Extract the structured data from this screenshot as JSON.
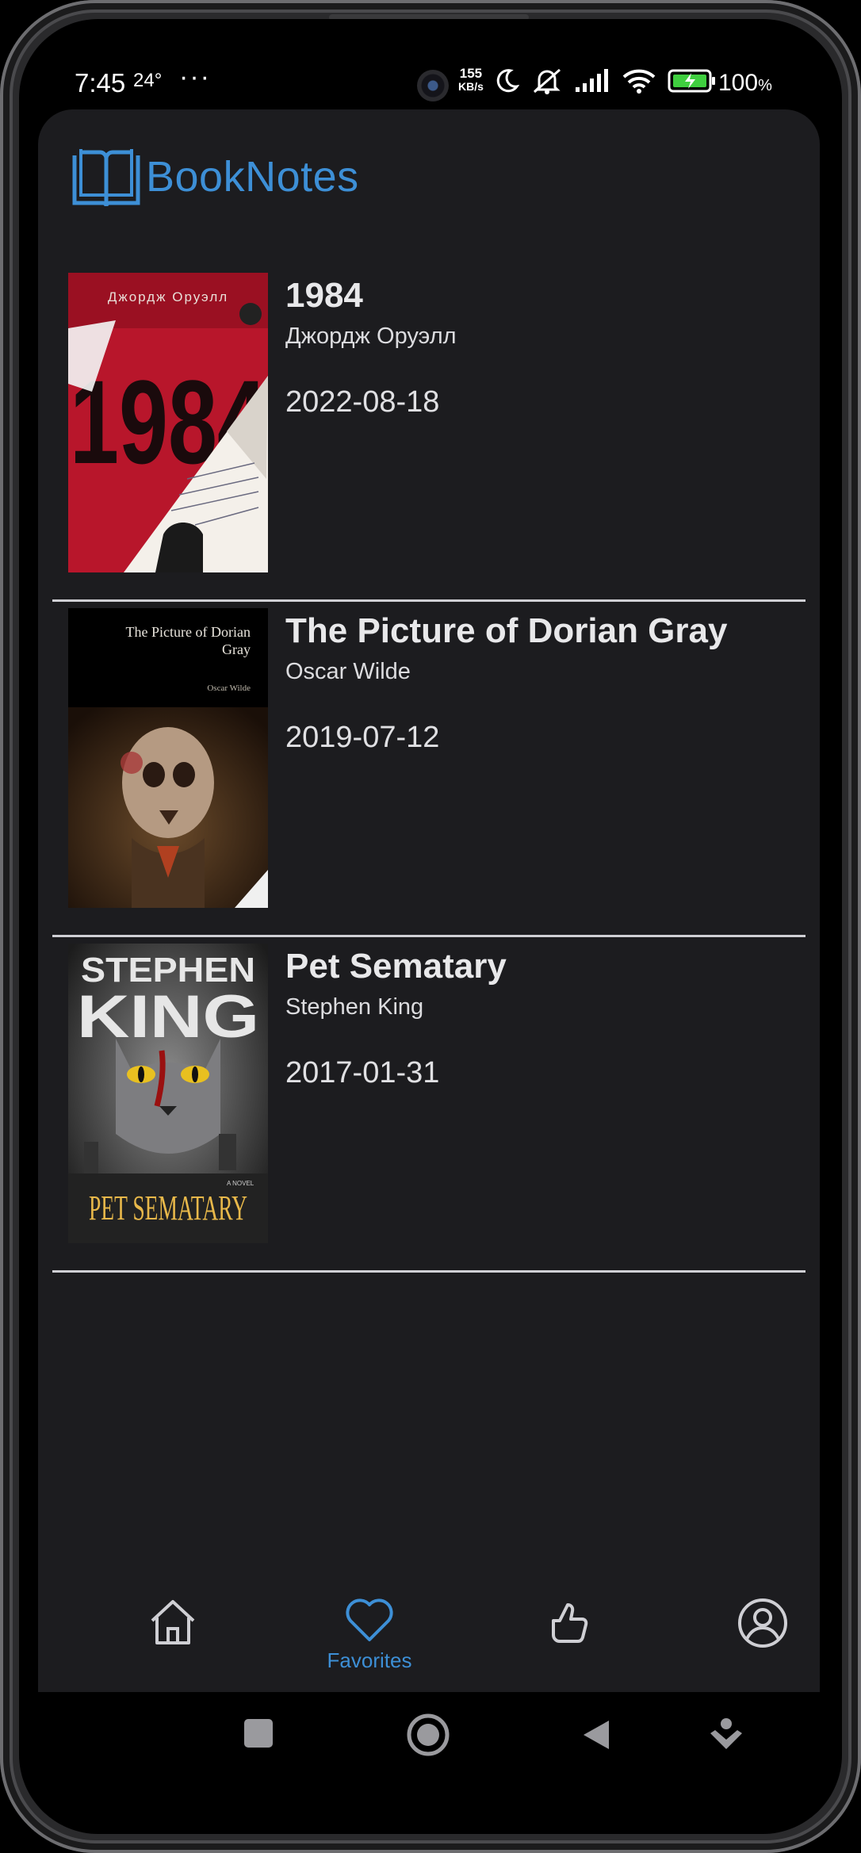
{
  "status_bar": {
    "time": "7:45",
    "temperature": "24°",
    "more": "···",
    "speed_value": "155",
    "speed_unit": "KB/s",
    "battery_percent": "100",
    "battery_unit": "%"
  },
  "app": {
    "name": "BookNotes",
    "accent_color": "#3d8fd6",
    "background_color": "#1c1c1f"
  },
  "books": [
    {
      "title": "1984",
      "author": "Джордж Оруэлл",
      "date": "2022-08-18",
      "cover": {
        "top_text": "Джордж Оруэлл",
        "big_text": "1984"
      }
    },
    {
      "title": "The Picture of Dorian Gray",
      "author": "Oscar Wilde",
      "date": "2019-07-12",
      "cover": {
        "title_line1": "The Picture of Dorian",
        "title_line2": "Gray",
        "author_text": "Oscar Wilde"
      }
    },
    {
      "title": "Pet Sematary",
      "author": "Stephen King",
      "date": "2017-01-31",
      "cover": {
        "author_line1": "STEPHEN",
        "author_line2": "KING",
        "title_text": "PET SEMATARY",
        "novel_text": "A NOVEL"
      }
    }
  ],
  "bottom_nav": {
    "active": "favorites",
    "items": [
      {
        "id": "home",
        "icon": "home-icon",
        "label": ""
      },
      {
        "id": "favorites",
        "icon": "heart-icon",
        "label": "Favorites"
      },
      {
        "id": "recommended",
        "icon": "thumbs-up-icon",
        "label": ""
      },
      {
        "id": "profile",
        "icon": "user-circle-icon",
        "label": ""
      }
    ]
  },
  "system_nav": {
    "buttons": [
      "recents-button",
      "home-button",
      "back-button",
      "assist-button"
    ]
  }
}
